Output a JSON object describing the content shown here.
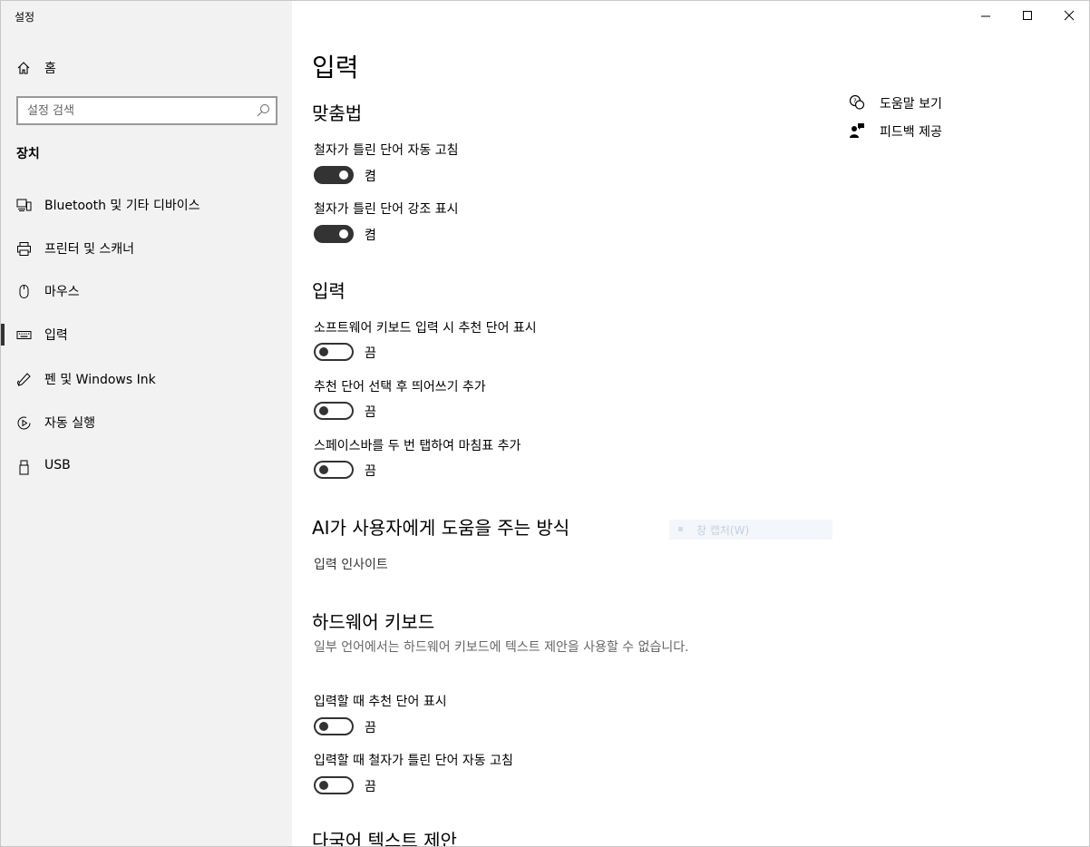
{
  "window": {
    "title": "설정"
  },
  "sidebar": {
    "home_label": "홈",
    "search_placeholder": "설정 검색",
    "section_title": "장치",
    "items": [
      {
        "label": "Bluetooth 및 기타 디바이스",
        "icon": "bluetooth-devices-icon"
      },
      {
        "label": "프린터 및 스캐너",
        "icon": "printer-icon"
      },
      {
        "label": "마우스",
        "icon": "mouse-icon"
      },
      {
        "label": "입력",
        "icon": "keyboard-icon",
        "active": true
      },
      {
        "label": "펜 및 Windows Ink",
        "icon": "pen-icon"
      },
      {
        "label": "자동 실행",
        "icon": "autoplay-icon"
      },
      {
        "label": "USB",
        "icon": "usb-icon"
      }
    ]
  },
  "main": {
    "title": "입력",
    "spell": {
      "heading": "맞춤법",
      "autocorrect_label": "철자가 틀린 단어 자동 고침",
      "autocorrect_state": "켬",
      "highlight_label": "철자가 틀린 단어 강조 표시",
      "highlight_state": "켬"
    },
    "typing": {
      "heading": "입력",
      "suggest_label": "소프트웨어 키보드 입력 시 추천 단어 표시",
      "suggest_state": "끔",
      "space_label": "추천 단어 선택 후 띄어쓰기 추가",
      "space_state": "끔",
      "period_label": "스페이스바를 두 번 탭하여 마침표 추가",
      "period_state": "끔"
    },
    "ai": {
      "heading": "AI가 사용자에게 도움을 주는 방식",
      "insights_link": "입력 인사이트"
    },
    "hardware": {
      "heading": "하드웨어 키보드",
      "description": "일부 언어에서는 하드웨어 키보드에 텍스트 제안을 사용할 수 없습니다.",
      "hw_suggest_label": "입력할 때 추천 단어 표시",
      "hw_suggest_state": "끔",
      "hw_autocorrect_label": "입력할 때 철자가 틀린 단어 자동 고침",
      "hw_autocorrect_state": "끔"
    },
    "multilingual": {
      "heading": "다국어 텍스트 제안"
    },
    "ghost_text": "창 캡처(W)"
  },
  "help": {
    "get_help": "도움말 보기",
    "feedback": "피드백 제공"
  },
  "toggles": {
    "autocorrect": true,
    "highlight": true,
    "suggest": false,
    "space": false,
    "period": false,
    "hw_suggest": false,
    "hw_autocorrect": false
  }
}
